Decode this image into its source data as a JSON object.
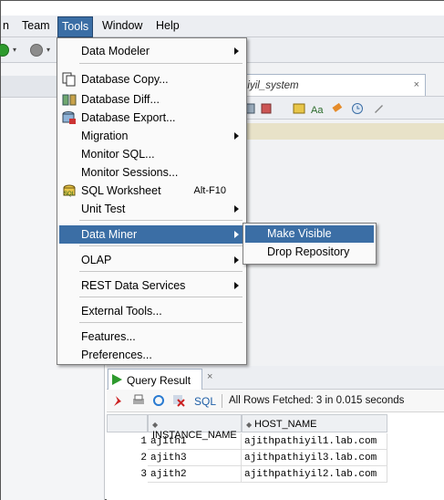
{
  "menubar": {
    "items": [
      {
        "label": "n"
      },
      {
        "label": "Team"
      },
      {
        "label": "Tools"
      },
      {
        "label": "Window"
      },
      {
        "label": "Help"
      }
    ]
  },
  "editor": {
    "tab_label": "hiyil_system",
    "tab_close": "×"
  },
  "tools_menu": {
    "items": [
      {
        "label": "Data Modeler",
        "icon": "none",
        "submenu": true
      },
      {
        "label": "Database Copy...",
        "icon": "database-copy-icon"
      },
      {
        "label": "Database Diff...",
        "icon": "database-diff-icon"
      },
      {
        "label": "Database Export...",
        "icon": "database-export-icon"
      },
      {
        "label": "Migration",
        "icon": "none",
        "submenu": true
      },
      {
        "label": "Monitor SQL...",
        "icon": "none"
      },
      {
        "label": "Monitor Sessions...",
        "icon": "none"
      },
      {
        "label": "SQL Worksheet",
        "icon": "sql-worksheet-icon",
        "shortcut": "Alt-F10"
      },
      {
        "label": "Unit Test",
        "icon": "none",
        "submenu": true
      },
      {
        "label": "Data Miner",
        "icon": "none",
        "submenu": true,
        "highlighted": true
      },
      {
        "label": "OLAP",
        "icon": "none",
        "submenu": true
      },
      {
        "label": "REST Data Services",
        "icon": "none",
        "submenu": true
      },
      {
        "label": "External Tools...",
        "icon": "none"
      },
      {
        "label": "Features...",
        "icon": "none"
      },
      {
        "label": "Preferences...",
        "icon": "none"
      }
    ]
  },
  "data_miner_submenu": {
    "items": [
      {
        "label": "Make Visible",
        "highlighted": true
      },
      {
        "label": "Drop Repository"
      }
    ]
  },
  "query_result": {
    "tab_label": "Query Result",
    "tab_close": "×",
    "sql_label": "SQL",
    "status": "All Rows Fetched: 3 in 0.015 seconds",
    "columns": [
      "INSTANCE_NAME",
      "HOST_NAME"
    ],
    "rows": [
      {
        "n": "1",
        "instance": "ajith1",
        "host": "ajithpathiyil1.lab.com"
      },
      {
        "n": "2",
        "instance": "ajith3",
        "host": "ajithpathiyil3.lab.com"
      },
      {
        "n": "3",
        "instance": "ajith2",
        "host": "ajithpathiyil2.lab.com"
      }
    ]
  },
  "colors": {
    "highlight": "#3b6ea5",
    "menubar_bg": "#eceef2",
    "accent_green": "#2e9a2e"
  }
}
